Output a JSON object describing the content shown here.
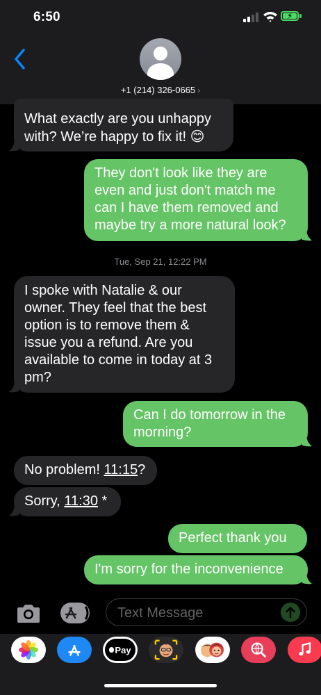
{
  "status": {
    "time": "6:50"
  },
  "header": {
    "contact": "+1 (214) 326-0665",
    "chevron": "›"
  },
  "messages": {
    "m1": {
      "l1": "What exactly are you unhappy",
      "l2a": "with? We’re happy to fix it! ",
      "emoji": "😊"
    },
    "m2": {
      "l1": "They don't look like they are",
      "l2": "even and just don't match me",
      "l3": "can I have them removed and",
      "l4": "maybe try a more natural look?"
    },
    "timestamp": "Tue, Sep 21, 12:22 PM",
    "m3": {
      "l1": "I spoke with Natalie & our",
      "l2": "owner. They feel that the best",
      "l3": "option is to remove them &",
      "l4": "issue you a refund. Are you",
      "l5": "available to come in today at 3",
      "l6": "pm?"
    },
    "m4": {
      "l1": "Can I do tomorrow in the",
      "l2": "morning?"
    },
    "m5": {
      "pre": "No problem! ",
      "time": "11:15",
      "post": "?"
    },
    "m6": {
      "pre": "Sorry, ",
      "time": "11:30",
      "post": " *"
    },
    "m7": {
      "text": "Perfect thank you"
    },
    "m8": {
      "text": "I'm sorry for the inconvenience"
    }
  },
  "input": {
    "placeholder": "Text Message"
  },
  "apps": {
    "applepay": "Pay"
  },
  "colors": {
    "incoming": "#262628",
    "outgoing": "#65c466",
    "accent": "#0a84ff"
  }
}
